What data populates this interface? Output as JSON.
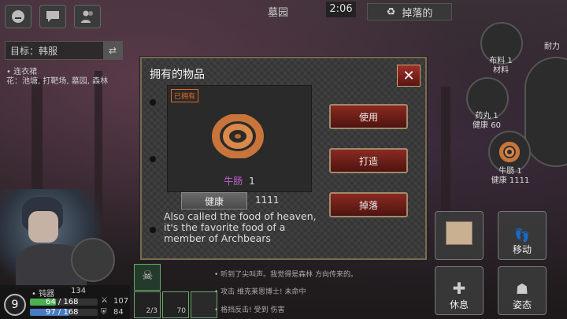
{
  "location": "墓园",
  "clock": "2:06",
  "drop_top_label": "掉落的",
  "target_label": "目标：韩服",
  "follower": {
    "title": "• 连衣裙",
    "line": "花：池塘, 打靶场, 墓园, 森林"
  },
  "dialog": {
    "title": "拥有的物品",
    "owned_tag": "已拥有",
    "item_name": "牛肠",
    "item_count": "1",
    "stat_label": "健康",
    "stat_value": "1111",
    "description": "Also called the food of heaven, it's the favorite food of a member of Archbears",
    "buttons": {
      "use": "使用",
      "craft": "打造",
      "drop": "掉落"
    }
  },
  "player": {
    "level": "9",
    "weapon_label": "• 钝器",
    "weapon_value": "134",
    "hp_text": "64 / 168",
    "hp_fraction": 0.38,
    "sp_text": "97 / 168",
    "sp_fraction": 0.58,
    "attack": "107",
    "defense": "84"
  },
  "skills": [
    {
      "count": "2/3"
    },
    {
      "count": "70"
    }
  ],
  "log": [
    "• 听到了尖叫声。我觉得是森林 方向传来的。",
    "• 攻击 维克莱恩博士! 未命中",
    "• 格挡反击! 受到 伤害"
  ],
  "actions": {
    "rest": "休息",
    "move": "移动",
    "pose": "姿态"
  },
  "side_items": [
    {
      "label": "布料 1",
      "sub": "材料"
    },
    {
      "label": "药丸 1",
      "sub": "健康 60"
    },
    {
      "label": "牛肠 1",
      "sub": "健康 1111"
    }
  ],
  "side_top_right": "耐力",
  "colors": {
    "accent_red": "#8a2a22",
    "item_purple": "#c060d0",
    "owned_orange": "#e06a20",
    "hp_green": "#4caf50",
    "sp_blue": "#4a7ac0"
  }
}
